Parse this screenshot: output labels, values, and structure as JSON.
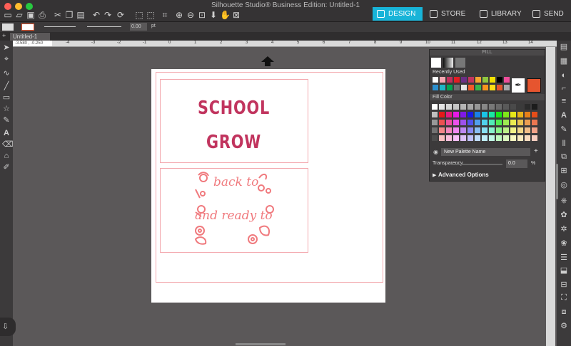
{
  "window": {
    "title": "Silhouette Studio® Business Edition: Untitled-1"
  },
  "nav": {
    "design": "DESIGN",
    "store": "STORE",
    "library": "LIBRARY",
    "send": "SEND"
  },
  "toolbar": {
    "line_width": "0.00",
    "line_unit": "pt"
  },
  "document": {
    "tab": "Untitled-1",
    "coords": "-3.580 , -0.250"
  },
  "ruler": {
    "ticks": [
      "-4",
      "-3",
      "-2",
      "-1",
      "0",
      "1",
      "2",
      "3",
      "4",
      "5",
      "6",
      "7",
      "8",
      "9",
      "10",
      "11",
      "12",
      "13",
      "14"
    ]
  },
  "design": {
    "line1": "SCHOOL",
    "line2": "GROW",
    "script1": "back to",
    "script2": "and ready to"
  },
  "colors": {
    "accent": "#18b4d8",
    "title_text": "#c1345e",
    "script_text": "#f07a7e",
    "cut_line": "#f3a8ae",
    "fill_selected": "#e6552f"
  },
  "fill_panel": {
    "title": "FILL",
    "recently_used": "Recently Used",
    "recent_colors": [
      "#ffffff",
      "#f4a6b0",
      "#c2305c",
      "#e11d24",
      "#6a2f86",
      "#c1345e",
      "#f6a531",
      "#8dc63f",
      "#f2e000",
      "#000000",
      "#ee4d9a",
      "#2b8fcf",
      "#1fb6c6",
      "#00a651",
      "#6d6e71",
      "#e7e7e7",
      "#f15a29",
      "#39b54a",
      "#f7941d",
      "#ffde17",
      "#e6552f",
      "#a7a9ac"
    ],
    "fill_color": "Fill Color",
    "palette_name": "New Palette Name",
    "transparency": "Transparency",
    "transparency_value": "0.0",
    "transparency_unit": "%",
    "advanced": "Advanced Options"
  }
}
